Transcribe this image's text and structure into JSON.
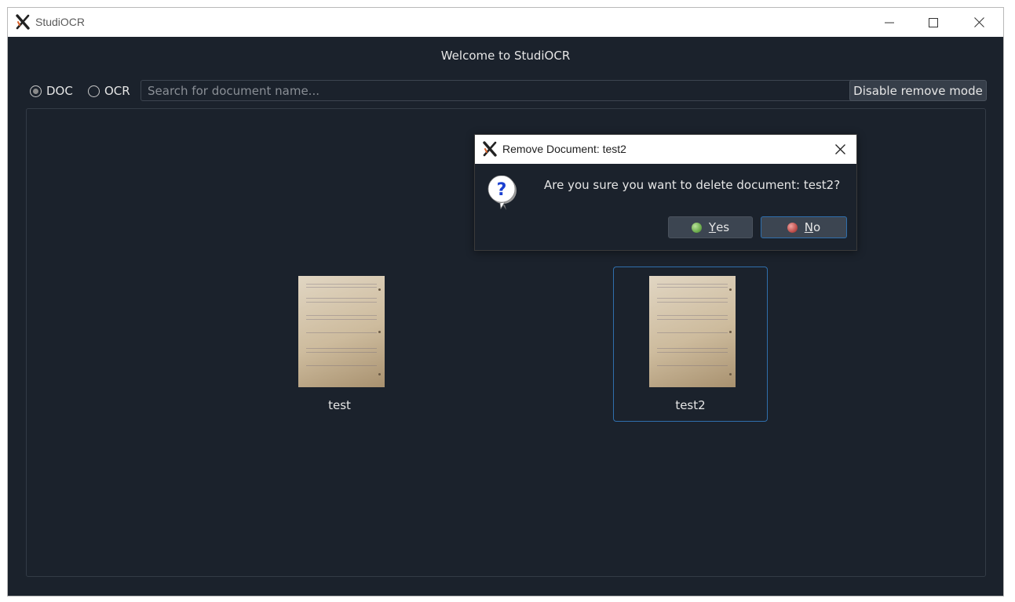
{
  "window": {
    "title": "StudiOCR",
    "controls": [
      "minimize-icon",
      "maximize-icon",
      "close-icon"
    ]
  },
  "header": {
    "welcome": "Welcome to StudiOCR"
  },
  "filters": {
    "doc_label": "DOC",
    "ocr_label": "OCR",
    "selected": "DOC"
  },
  "search": {
    "placeholder": "Search for document name...",
    "value": ""
  },
  "toolbar": {
    "remove_mode_label": "Disable remove mode"
  },
  "documents": [
    {
      "name": "test",
      "selected": false,
      "icon": "document-thumbnail"
    },
    {
      "name": "test2",
      "selected": true,
      "icon": "document-thumbnail"
    }
  ],
  "dialog": {
    "title": "Remove Document: test2",
    "message": "Are you sure you want to delete document: test2?",
    "icon": "question-icon",
    "yes": {
      "mnemonic": "Y",
      "rest": "es",
      "icon": "green-led-icon"
    },
    "no": {
      "mnemonic": "N",
      "rest": "o",
      "icon": "red-led-icon"
    }
  },
  "colors": {
    "background": "#1b222c",
    "button": "#363e49",
    "focus_border": "#2f6fad",
    "text": "#e6e6e6",
    "yes_led": "#6fae4f",
    "no_led": "#c0504d"
  }
}
